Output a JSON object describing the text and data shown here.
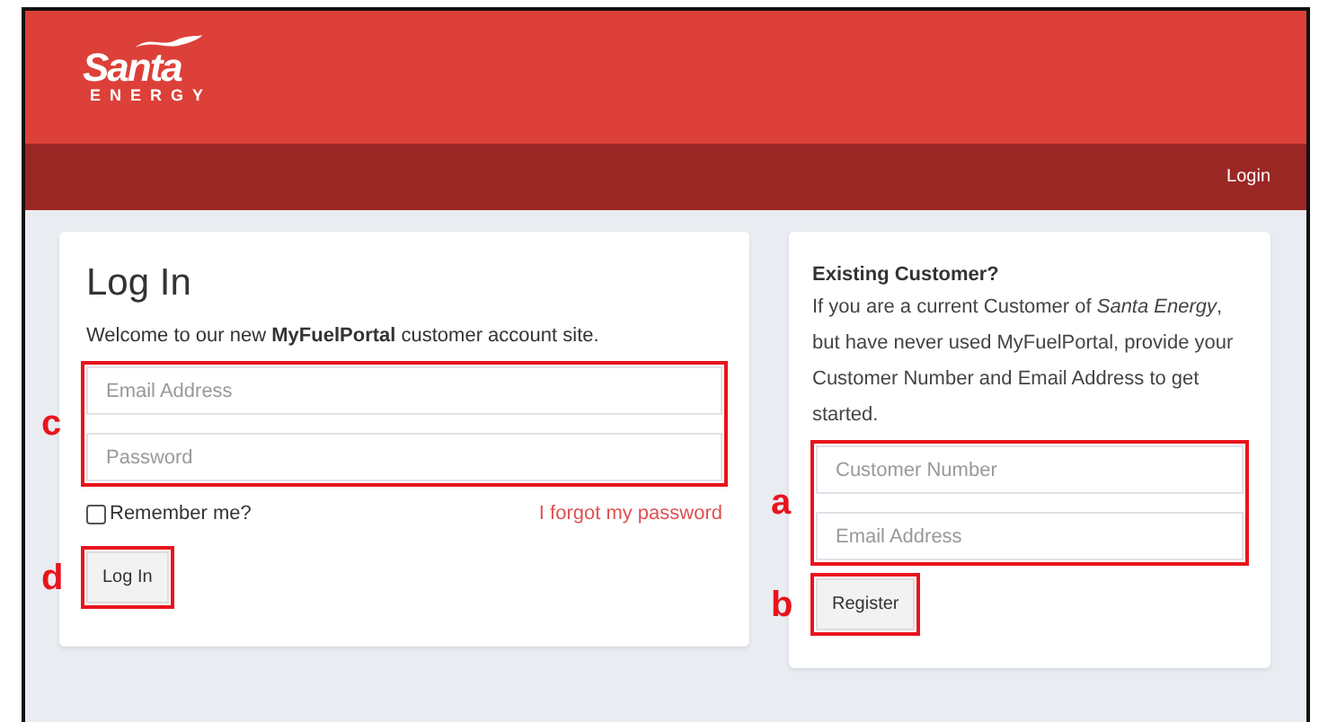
{
  "header": {
    "logo": {
      "name": "Santa",
      "tagline": "ENERGY"
    }
  },
  "nav": {
    "links": [
      {
        "label": "Login"
      }
    ]
  },
  "login_card": {
    "title": "Log In",
    "intro": "Welcome to our new **MyFuelPortal** customer account site.",
    "fields": [
      {
        "placeholder": "Email Address"
      },
      {
        "placeholder": "Password"
      }
    ],
    "fields_annotation": "c",
    "remember": {
      "label": "Remember me?",
      "checked": false
    },
    "forgot_link": "I forgot my password",
    "button": {
      "label": "Log In",
      "annotation": "d"
    }
  },
  "register_card": {
    "heading": "Existing Customer?",
    "text": "If you are a current Customer of *Santa Energy*, but have never used MyFuelPortal, provide your Customer Number and Email Address to get started.",
    "fields": [
      {
        "placeholder": "Customer Number"
      },
      {
        "placeholder": "Email Address"
      }
    ],
    "fields_annotation": "a",
    "button": {
      "label": "Register",
      "annotation": "b"
    }
  }
}
